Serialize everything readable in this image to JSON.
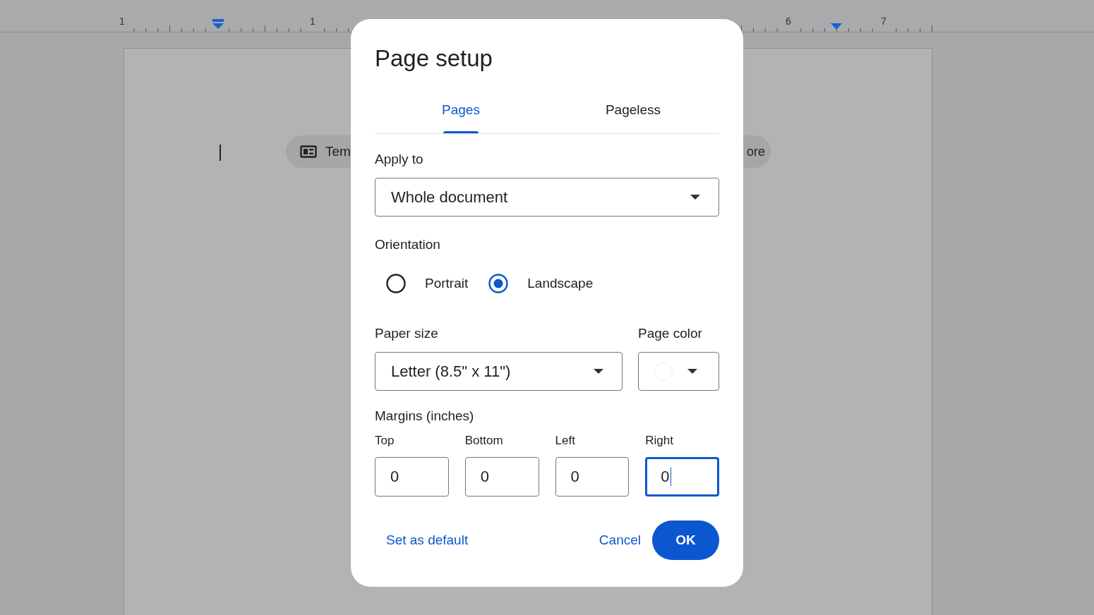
{
  "ruler": {
    "labels": [
      "1",
      "1",
      "6",
      "7"
    ]
  },
  "document": {
    "chips": [
      {
        "label": "Tem",
        "kind": "template"
      },
      {
        "label": "ore",
        "kind": "more"
      }
    ]
  },
  "dialog": {
    "title": "Page setup",
    "tabs": [
      {
        "label": "Pages",
        "selected": true
      },
      {
        "label": "Pageless",
        "selected": false
      }
    ],
    "apply_to": {
      "label": "Apply to",
      "value": "Whole document"
    },
    "orientation": {
      "label": "Orientation",
      "options": [
        {
          "label": "Portrait",
          "selected": false
        },
        {
          "label": "Landscape",
          "selected": true
        }
      ]
    },
    "paper_size": {
      "label": "Paper size",
      "value": "Letter (8.5\" x 11\")"
    },
    "page_color": {
      "label": "Page color",
      "color": "#ffffff"
    },
    "margins": {
      "label": "Margins (inches)",
      "fields": [
        {
          "label": "Top",
          "value": "0",
          "focused": false
        },
        {
          "label": "Bottom",
          "value": "0",
          "focused": false
        },
        {
          "label": "Left",
          "value": "0",
          "focused": false
        },
        {
          "label": "Right",
          "value": "0",
          "focused": true
        }
      ]
    },
    "buttons": {
      "set_default": "Set as default",
      "cancel": "Cancel",
      "ok": "OK"
    }
  }
}
